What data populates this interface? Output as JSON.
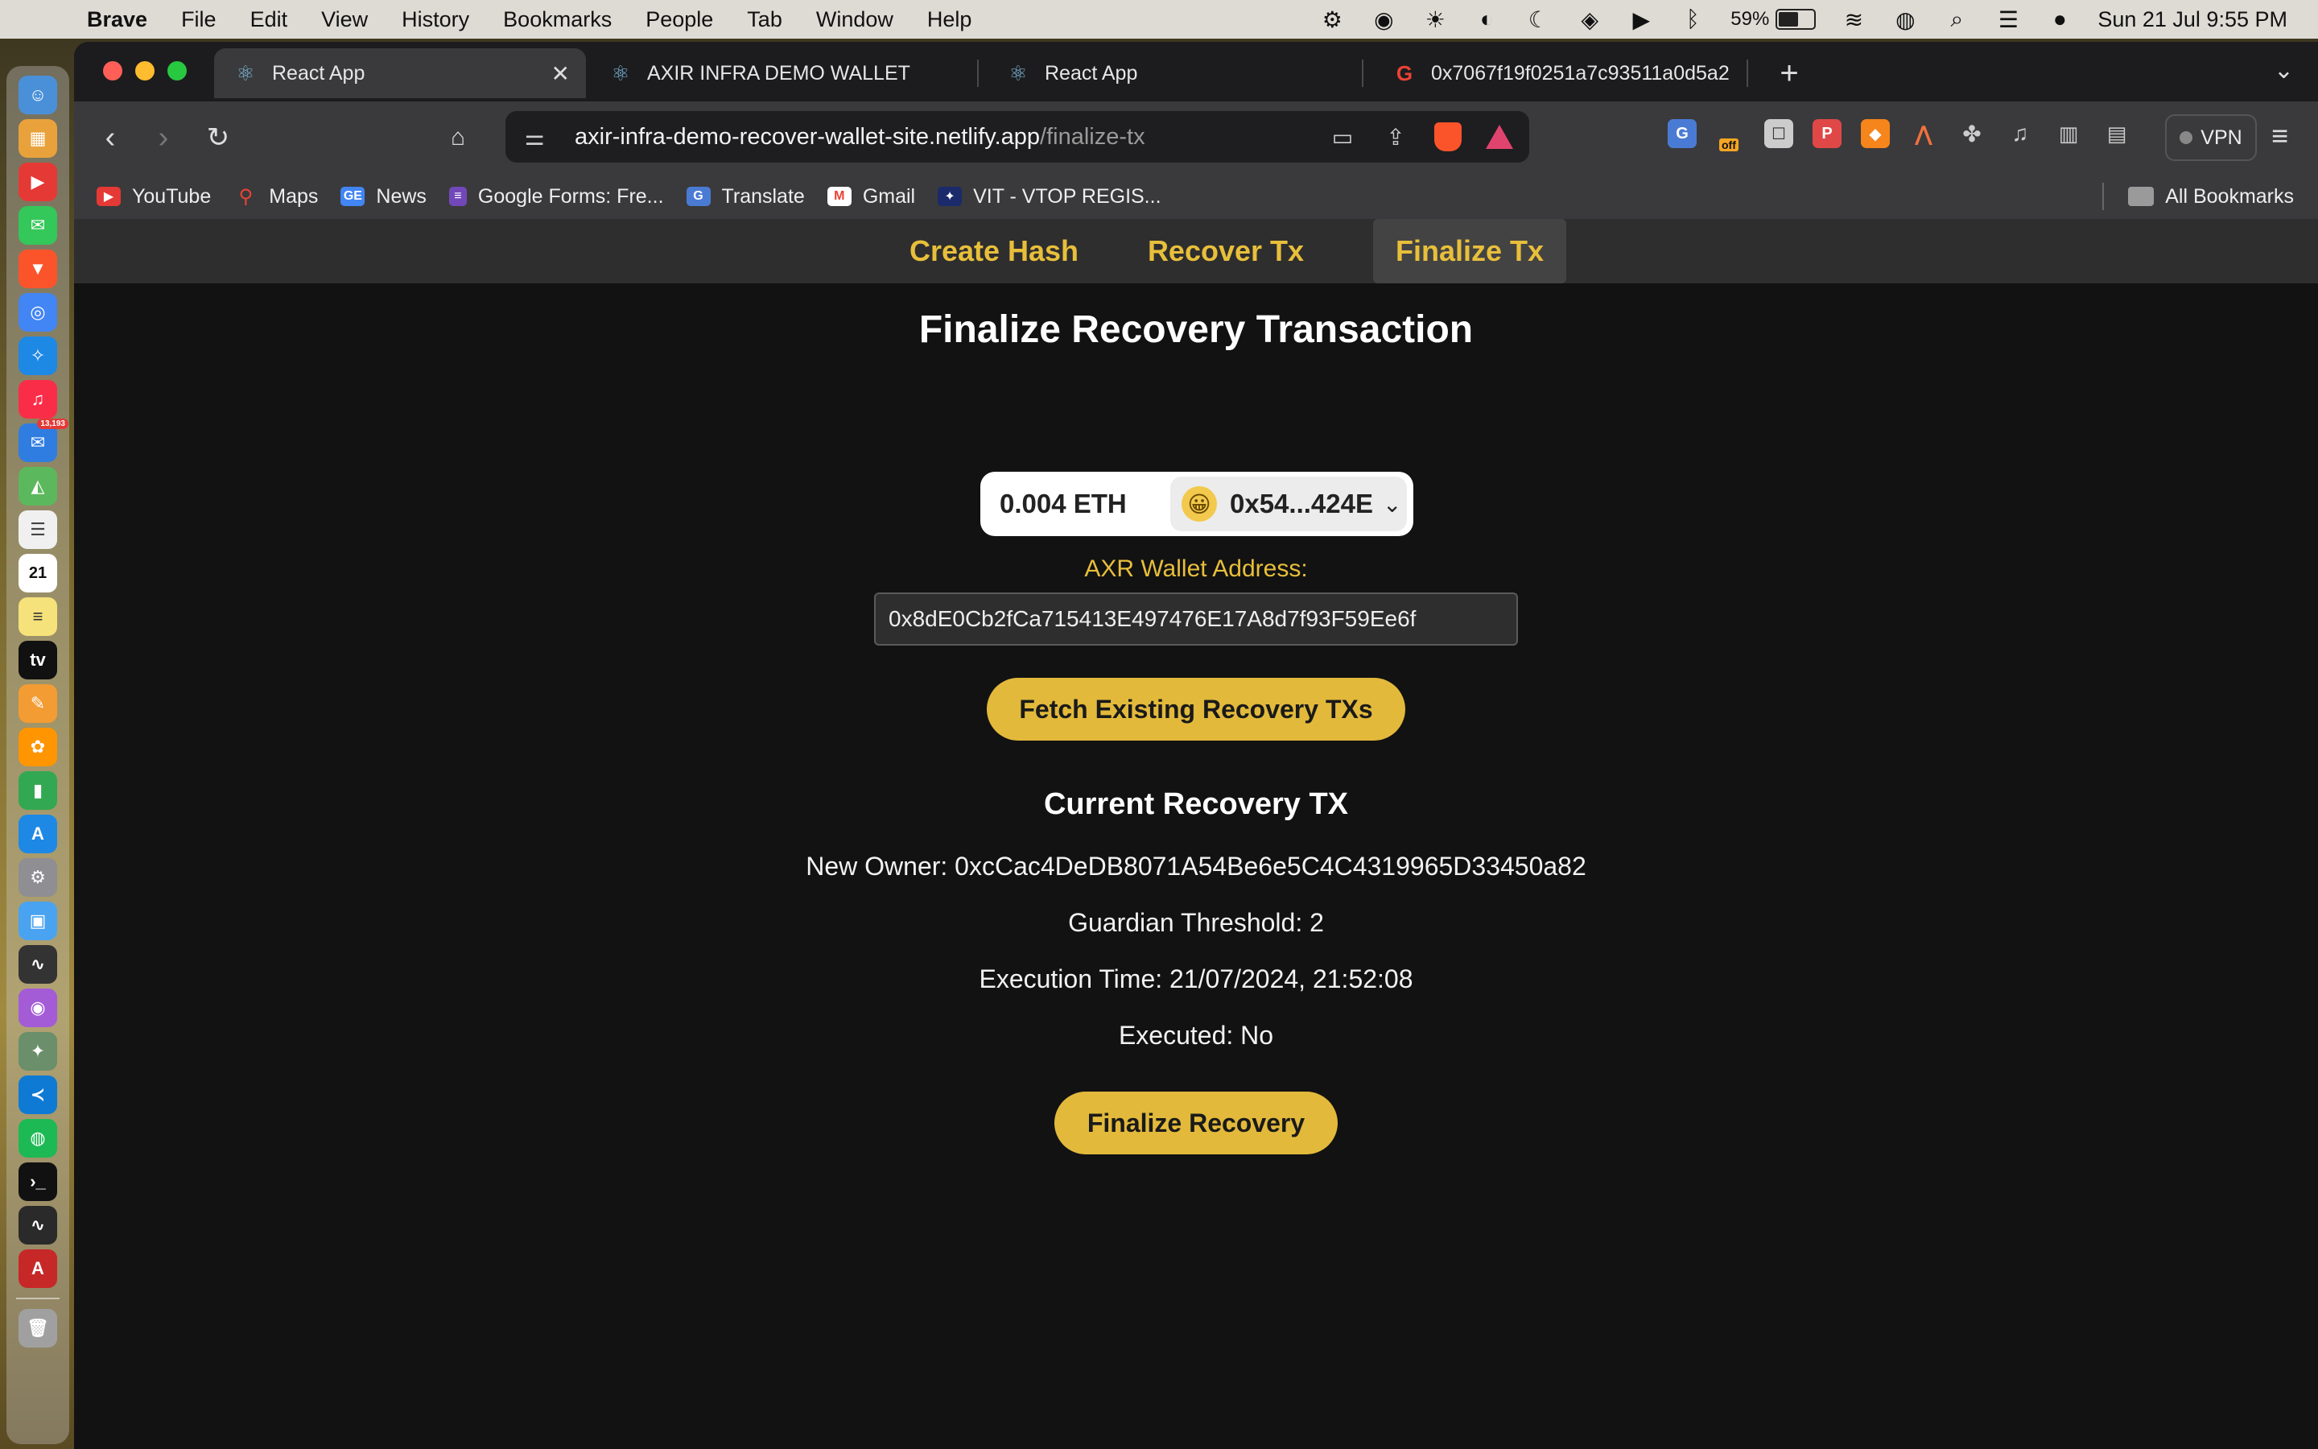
{
  "menubar": {
    "app_name": "Brave",
    "menus": [
      "File",
      "Edit",
      "View",
      "History",
      "Bookmarks",
      "People",
      "Tab",
      "Window",
      "Help"
    ],
    "battery_percent": "59%",
    "battery_level": 0.59,
    "datetime": "Sun 21 Jul  9:55 PM"
  },
  "dock": {
    "mail_badge": "13,193",
    "calendar_day": "21"
  },
  "tabs": [
    {
      "title": "React App",
      "active": true
    },
    {
      "title": "AXIR INFRA DEMO WALLET",
      "active": false
    },
    {
      "title": "React App",
      "active": false
    },
    {
      "title": "0x7067f19f0251a7c93511a0d5a2",
      "active": false
    }
  ],
  "urlbar": {
    "host": "axir-infra-demo-recover-wallet-site.netlify.app",
    "path": "/finalize-tx"
  },
  "toolbar": {
    "vpn_label": "VPN",
    "ext_off_badge": "off"
  },
  "bookmarks": {
    "items": [
      "YouTube",
      "Maps",
      "News",
      "Google Forms: Fre...",
      "Translate",
      "Gmail",
      "VIT - VTOP REGIS..."
    ],
    "all_label": "All Bookmarks"
  },
  "appnav": {
    "links": [
      "Create Hash",
      "Recover Tx",
      "Finalize Tx"
    ],
    "active": "Finalize Tx"
  },
  "main": {
    "title": "Finalize Recovery Transaction",
    "wallet": {
      "balance": "0.004 ETH",
      "account": "0x54...424E",
      "avatar_emoji": "😀"
    },
    "axr_label": "AXR Wallet Address:",
    "axr_value": "0x8dE0Cb2fCa715413E497476E17A8d7f93F59Ee6f",
    "fetch_button": "Fetch Existing Recovery TXs",
    "current_title": "Current Recovery TX",
    "new_owner": "New Owner: 0xcCac4DeDB8071A54Be6e5C4C4319965D33450a82",
    "guardian_threshold": "Guardian Threshold: 2",
    "execution_time": "Execution Time: 21/07/2024, 21:52:08",
    "executed": "Executed: No",
    "finalize_button": "Finalize Recovery"
  }
}
